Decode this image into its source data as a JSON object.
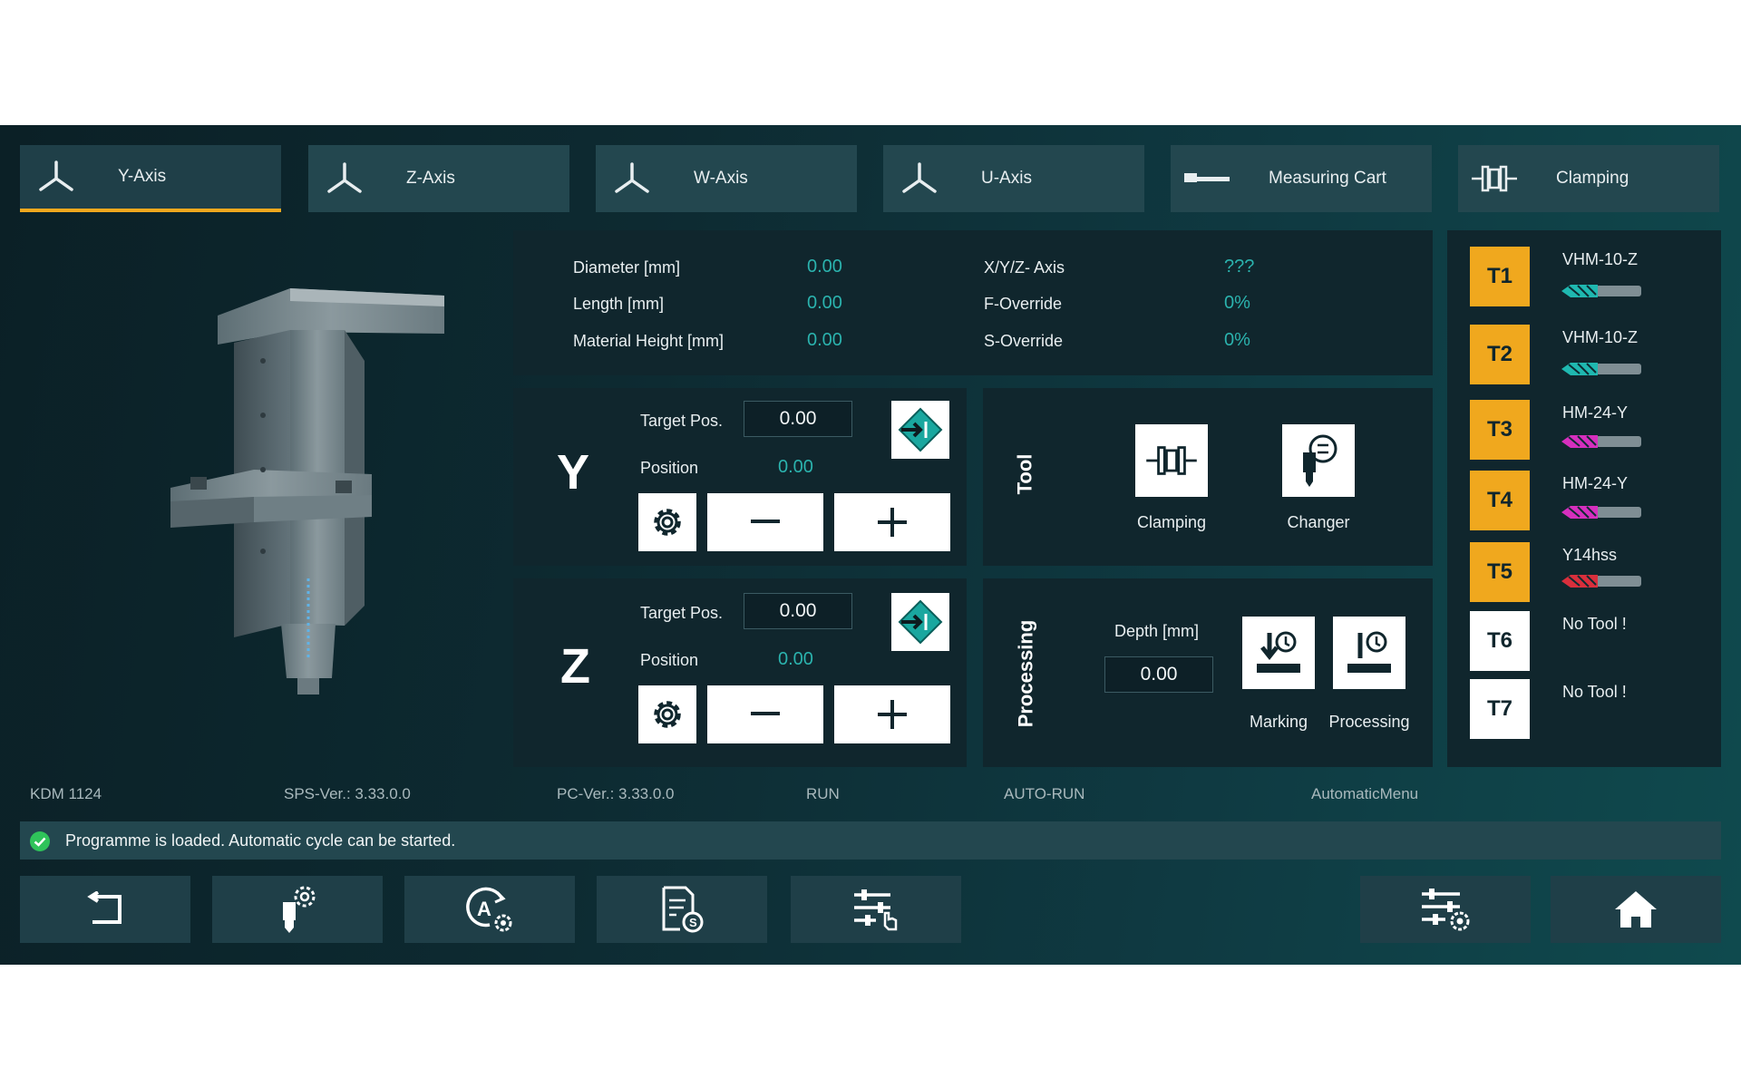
{
  "tabs": [
    {
      "label": "Y-Axis",
      "icon": "axis-icon",
      "active": true
    },
    {
      "label": "Z-Axis",
      "icon": "axis-icon",
      "active": false
    },
    {
      "label": "W-Axis",
      "icon": "axis-icon",
      "active": false
    },
    {
      "label": "U-Axis",
      "icon": "axis-icon",
      "active": false
    },
    {
      "label": "Measuring Cart",
      "icon": "measuring-cart-icon",
      "active": false
    },
    {
      "label": "Clamping",
      "icon": "clamping-icon",
      "active": false
    }
  ],
  "info": {
    "diameter_label": "Diameter [mm]",
    "diameter_value": "0.00",
    "length_label": "Length [mm]",
    "length_value": "0.00",
    "material_label": "Material Height [mm]",
    "material_value": "0.00",
    "xyz_label": "X/Y/Z- Axis",
    "xyz_value": "???",
    "f_label": "F-Override",
    "f_value": "0%",
    "s_label": "S-Override",
    "s_value": "0%"
  },
  "axis_y": {
    "letter": "Y",
    "target_label": "Target Pos.",
    "target_value": "0.00",
    "position_label": "Position",
    "position_value": "0.00"
  },
  "axis_z": {
    "letter": "Z",
    "target_label": "Target Pos.",
    "target_value": "0.00",
    "position_label": "Position",
    "position_value": "0.00"
  },
  "tool_panel": {
    "title": "Tool",
    "clamping_label": "Clamping",
    "changer_label": "Changer"
  },
  "processing_panel": {
    "title": "Processing",
    "depth_label": "Depth [mm]",
    "depth_value": "0.00",
    "marking_label": "Marking",
    "processing_label": "Processing"
  },
  "tools": [
    {
      "id": "T1",
      "name": "VHM-10-Z",
      "badge": "#f0a81e",
      "tip": "#1fb8b0"
    },
    {
      "id": "T2",
      "name": "VHM-10-Z",
      "badge": "#f0a81e",
      "tip": "#1fb8b0"
    },
    {
      "id": "T3",
      "name": "HM-24-Y",
      "badge": "#f0a81e",
      "tip": "#d62fbe"
    },
    {
      "id": "T4",
      "name": "HM-24-Y",
      "badge": "#f0a81e",
      "tip": "#d62fbe"
    },
    {
      "id": "T5",
      "name": "Y14hss",
      "badge": "#f0a81e",
      "tip": "#d92f3c"
    },
    {
      "id": "T6",
      "name": "No Tool !",
      "badge": "#ffffff",
      "tip": ""
    },
    {
      "id": "T7",
      "name": "No Tool !",
      "badge": "#ffffff",
      "tip": ""
    }
  ],
  "statusbar": {
    "machine": "KDM 1124",
    "sps": "SPS-Ver.: 3.33.0.0",
    "pc": "PC-Ver.: 3.33.0.0",
    "run": "RUN",
    "auto": "AUTO-RUN",
    "menu": "AutomaticMenu"
  },
  "message": {
    "text": "Programme is loaded. Automatic cycle can be started.",
    "color": "#2fc35a"
  },
  "bottom_buttons": [
    "back-icon",
    "tool-settings-icon",
    "auto-settings-icon",
    "program-icon",
    "manual-adjust-icon",
    "settings-sliders-icon",
    "home-icon"
  ],
  "colors": {
    "accent": "#f0a81e",
    "value": "#2bb3ae",
    "panel": "#10262d"
  }
}
